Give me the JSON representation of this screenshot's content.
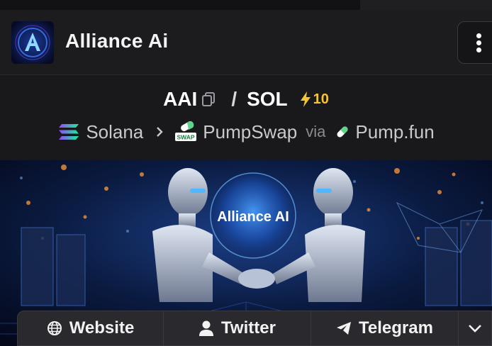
{
  "header": {
    "title": "Alliance Ai",
    "avatar_icon": "alliance-ai-logo",
    "menu_icon": "vertical-dots-icon"
  },
  "pair": {
    "base": "AAI",
    "separator": "/",
    "quote": "SOL",
    "boost_count": "10",
    "boost_color": "#f5c531"
  },
  "route": {
    "chain": "Solana",
    "dex": "PumpSwap",
    "dex_icon_label": "SWAP",
    "via": "via",
    "launchpad": "Pump.fun"
  },
  "banner": {
    "caption": "Alliance AI"
  },
  "links": {
    "website": "Website",
    "twitter": "Twitter",
    "telegram": "Telegram"
  }
}
